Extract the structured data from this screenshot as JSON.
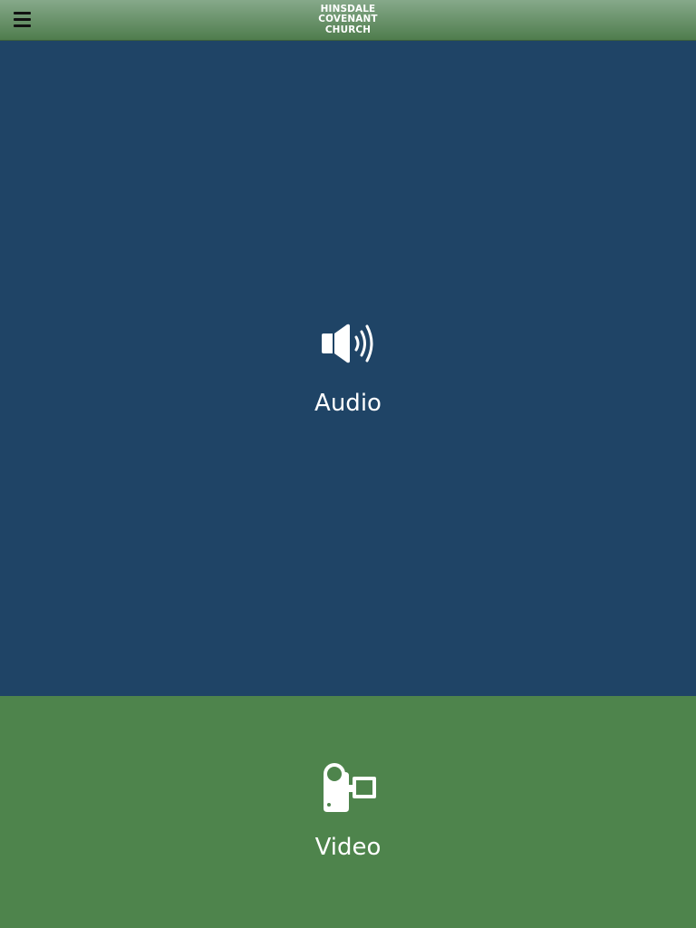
{
  "header": {
    "logo_line1": "HINSDALE",
    "logo_line2": "COVENANT",
    "logo_line3": "CHURCH"
  },
  "menu": {
    "icon": "hamburger-menu-icon"
  },
  "panels": {
    "audio": {
      "label": "Audio",
      "icon": "speaker-icon"
    },
    "video": {
      "label": "Video",
      "icon": "video-camera-icon"
    }
  },
  "colors": {
    "header_top": "#86a98a",
    "header_bottom": "#4f7d4d",
    "audio_bg": "#1f4466",
    "video_bg": "#4e844c",
    "text": "#ffffff"
  }
}
